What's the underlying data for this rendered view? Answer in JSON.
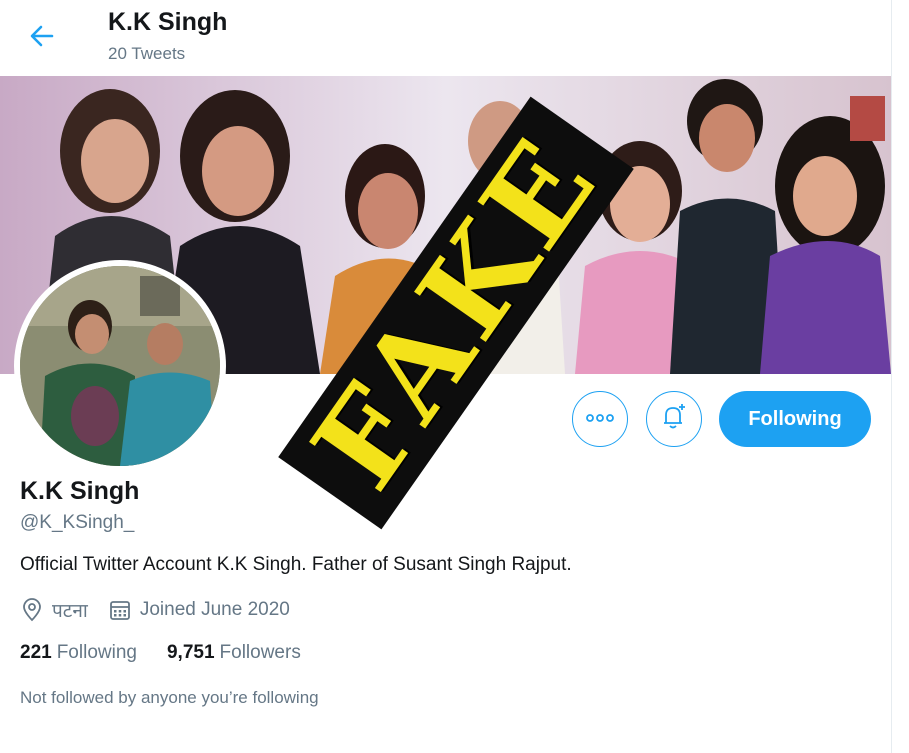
{
  "header": {
    "name": "K.K Singh",
    "tweet_count": "20 Tweets",
    "back_icon": "arrow-left-icon"
  },
  "profile": {
    "name": "K.K Singh",
    "handle": "@K_KSingh_",
    "bio": "Official Twitter Account K.K Singh. Father of Susant Singh Rajput.",
    "location": "पटना",
    "joined": "Joined June 2020",
    "following_count": "221",
    "following_label": "Following",
    "followers_count": "9,751",
    "followers_label": "Followers",
    "note": "Not followed by anyone you’re following"
  },
  "actions": {
    "more_icon": "more-dots-icon",
    "notify_icon": "bell-plus-icon",
    "follow_label": "Following"
  },
  "stamp": {
    "text": "FAKE"
  },
  "colors": {
    "accent": "#1da1f2",
    "secondary_text": "#657786",
    "stamp_bg": "#0d0d0d",
    "stamp_text": "#f3e21a"
  }
}
